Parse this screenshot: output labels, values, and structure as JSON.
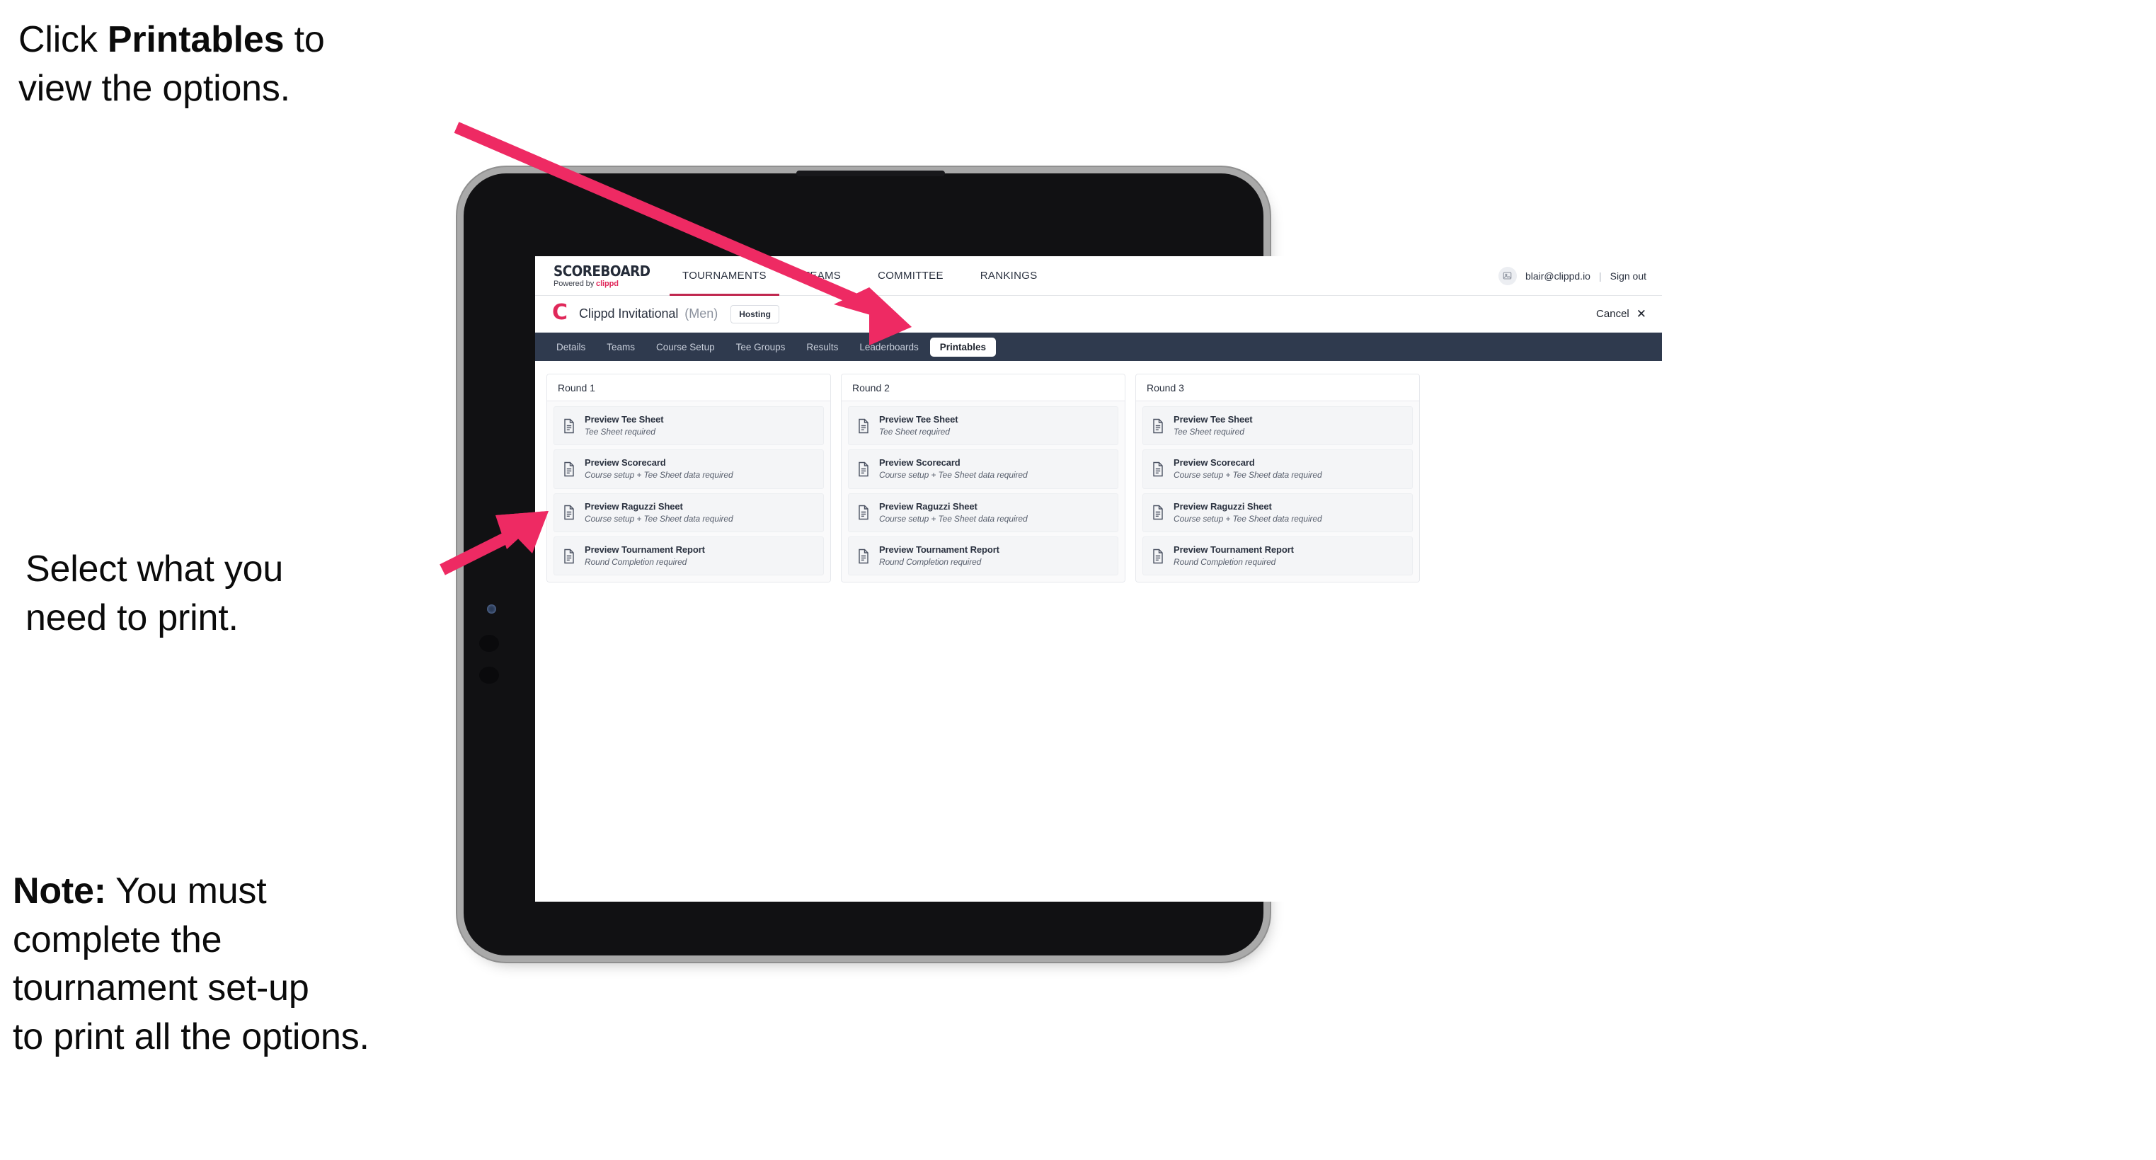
{
  "annotations": [
    {
      "id": "annot-1",
      "segments": [
        {
          "text": "Click ",
          "bold": false
        },
        {
          "text": "Printables",
          "bold": true
        },
        {
          "text": " to\nview the options.",
          "bold": false
        }
      ]
    },
    {
      "id": "annot-2",
      "segments": [
        {
          "text": "Select what you\n need to print.",
          "bold": false
        }
      ]
    },
    {
      "id": "annot-3",
      "segments": [
        {
          "text": "Note:",
          "bold": true
        },
        {
          "text": " You must\ncomplete the\ntournament set-up\nto print all the options.",
          "bold": false
        }
      ]
    }
  ],
  "colors": {
    "accent_pink": "#ee2a63",
    "brand_crimson": "#e0285a",
    "subnav_navy": "#2f3a4e",
    "text_dark": "#2b3240"
  },
  "app": {
    "logo": {
      "wordmark": "SCOREBOARD",
      "powered_prefix": "Powered by ",
      "powered_brand": "clippd"
    },
    "main_nav": [
      {
        "label": "TOURNAMENTS",
        "active": true
      },
      {
        "label": "TEAMS",
        "active": false
      },
      {
        "label": "COMMITTEE",
        "active": false
      },
      {
        "label": "RANKINGS",
        "active": false
      }
    ],
    "account": {
      "avatar_icon": "user-avatar-icon",
      "email": "blair@clippd.io",
      "separator": "|",
      "sign_out_label": "Sign out"
    },
    "tournament": {
      "logo_letter": "C",
      "name": "Clippd Invitational",
      "gender": "(Men)",
      "status_badge": "Hosting",
      "cancel_label": "Cancel",
      "cancel_icon": "close-icon"
    },
    "subnav": [
      {
        "label": "Details",
        "active": false
      },
      {
        "label": "Teams",
        "active": false
      },
      {
        "label": "Course Setup",
        "active": false
      },
      {
        "label": "Tee Groups",
        "active": false
      },
      {
        "label": "Results",
        "active": false
      },
      {
        "label": "Leaderboards",
        "active": false
      },
      {
        "label": "Printables",
        "active": true
      }
    ],
    "rounds": [
      {
        "title": "Round 1",
        "items": [
          {
            "title": "Preview Tee Sheet",
            "requirement": "Tee Sheet required",
            "icon": "document-icon"
          },
          {
            "title": "Preview Scorecard",
            "requirement": "Course setup + Tee Sheet data required",
            "icon": "document-icon"
          },
          {
            "title": "Preview Raguzzi Sheet",
            "requirement": "Course setup + Tee Sheet data required",
            "icon": "document-icon"
          },
          {
            "title": "Preview Tournament Report",
            "requirement": "Round Completion required",
            "icon": "document-icon"
          }
        ]
      },
      {
        "title": "Round 2",
        "items": [
          {
            "title": "Preview Tee Sheet",
            "requirement": "Tee Sheet required",
            "icon": "document-icon"
          },
          {
            "title": "Preview Scorecard",
            "requirement": "Course setup + Tee Sheet data required",
            "icon": "document-icon"
          },
          {
            "title": "Preview Raguzzi Sheet",
            "requirement": "Course setup + Tee Sheet data required",
            "icon": "document-icon"
          },
          {
            "title": "Preview Tournament Report",
            "requirement": "Round Completion required",
            "icon": "document-icon"
          }
        ]
      },
      {
        "title": "Round 3",
        "items": [
          {
            "title": "Preview Tee Sheet",
            "requirement": "Tee Sheet required",
            "icon": "document-icon"
          },
          {
            "title": "Preview Scorecard",
            "requirement": "Course setup + Tee Sheet data required",
            "icon": "document-icon"
          },
          {
            "title": "Preview Raguzzi Sheet",
            "requirement": "Course setup + Tee Sheet data required",
            "icon": "document-icon"
          },
          {
            "title": "Preview Tournament Report",
            "requirement": "Round Completion required",
            "icon": "document-icon"
          }
        ]
      }
    ]
  }
}
